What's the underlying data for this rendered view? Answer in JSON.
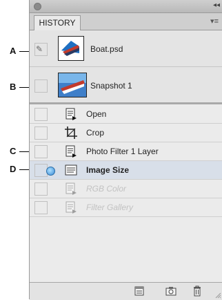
{
  "panel": {
    "tab_label": "HISTORY",
    "collapse_glyph": "◂◂",
    "menu_glyph": "▾≡"
  },
  "callouts": [
    {
      "letter": "A"
    },
    {
      "letter": "B"
    },
    {
      "letter": "C"
    },
    {
      "letter": "D"
    }
  ],
  "snapshots": [
    {
      "label": "Boat.psd",
      "icon": "boat-thumbnail"
    },
    {
      "label": "Snapshot 1",
      "icon": "boat-thumbnail"
    }
  ],
  "states": [
    {
      "label": "Open",
      "icon": "document-action-icon",
      "selected": false,
      "disabled": false
    },
    {
      "label": "Crop",
      "icon": "crop-icon",
      "selected": false,
      "disabled": false
    },
    {
      "label": "Photo Filter 1 Layer",
      "icon": "document-action-icon",
      "selected": false,
      "disabled": false
    },
    {
      "label": "Image Size",
      "icon": "image-size-icon",
      "selected": true,
      "disabled": false
    },
    {
      "label": "RGB Color",
      "icon": "document-action-icon",
      "selected": false,
      "disabled": true
    },
    {
      "label": "Filter Gallery",
      "icon": "document-action-icon",
      "selected": false,
      "disabled": true
    }
  ],
  "bottom_buttons": [
    {
      "name": "create-new-document-from-state",
      "icon": "new-document-icon"
    },
    {
      "name": "create-new-snapshot",
      "icon": "camera-icon"
    },
    {
      "name": "delete-state",
      "icon": "trash-icon"
    }
  ],
  "colors": {
    "selection": "#d8dfe9",
    "marker": "#3a8bd6"
  }
}
